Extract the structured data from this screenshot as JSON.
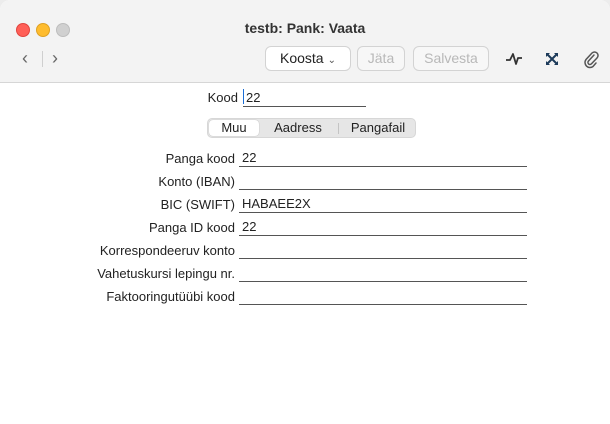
{
  "window": {
    "title": "testb: Pank: Vaata"
  },
  "toolbar": {
    "back_icon": "chevron-left-icon",
    "forward_icon": "chevron-right-icon",
    "koosta_label": "Koosta",
    "jata_label": "Jäta",
    "salvesta_label": "Salvesta",
    "icons": [
      "activity-icon",
      "expand-icon",
      "paperclip-icon"
    ]
  },
  "form": {
    "kood_label": "Kood",
    "kood_value": "22",
    "tabs": [
      {
        "label": "Muu",
        "active": true
      },
      {
        "label": "Aadress",
        "active": false
      },
      {
        "label": "Pangafail",
        "active": false
      }
    ],
    "fields": [
      {
        "label": "Panga kood",
        "value": "22"
      },
      {
        "label": "Konto (IBAN)",
        "value": ""
      },
      {
        "label": "BIC (SWIFT)",
        "value": "HABAEE2X"
      },
      {
        "label": "Panga ID kood",
        "value": "22"
      },
      {
        "label": "Korrespondeeruv konto",
        "value": ""
      },
      {
        "label": "Vahetuskursi lepingu nr.",
        "value": ""
      },
      {
        "label": "Faktooringutüübi kood",
        "value": ""
      }
    ]
  },
  "colors": {
    "close": "#ff5f57",
    "minimize": "#febc2e",
    "zoom_disabled": "#d0d0d0",
    "cursor": "#1a6dd6",
    "disabled_text": "#b8b8b8"
  }
}
